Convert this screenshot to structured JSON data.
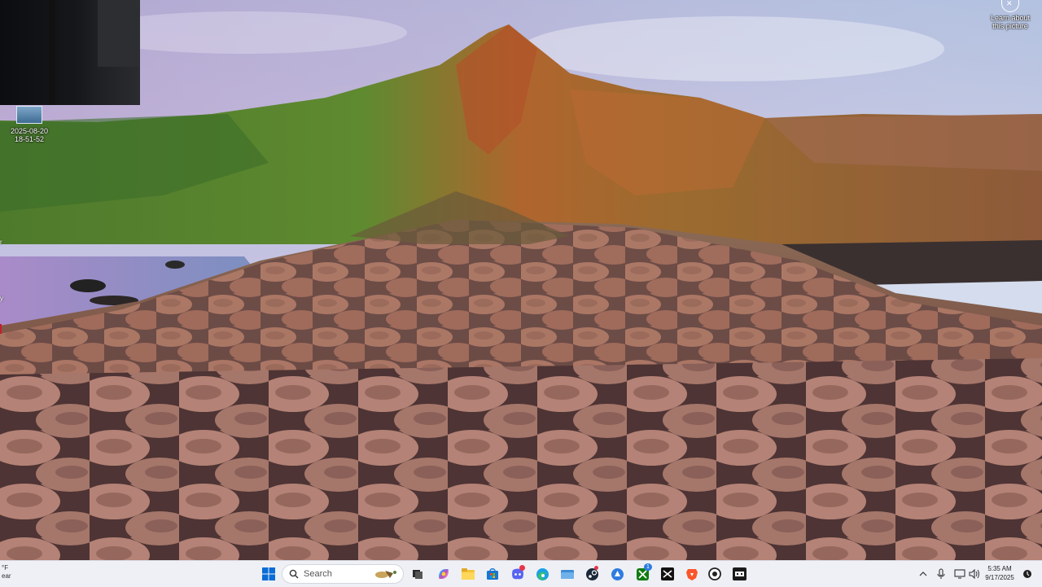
{
  "desktop": {
    "icon": {
      "label_line1": "2025-08-20",
      "label_line2": "18-51-52"
    },
    "learn_picture": {
      "line1": "Learn about",
      "line2": "this picture"
    },
    "edge_fragments": [
      "r",
      "y"
    ]
  },
  "taskbar": {
    "weather": {
      "temp": "°F",
      "condition": "ear"
    },
    "search": {
      "label": "Search"
    },
    "pinned_apps": [
      "start-icon",
      "search-box",
      "task-view-icon",
      "copilot-icon",
      "file-explorer-icon",
      "microsoft-store-icon",
      "discord-icon",
      "edge-icon",
      "files-app-icon",
      "steam-icon",
      "app-icon",
      "xbox-icon",
      "capcut-icon",
      "brave-icon",
      "github-icon",
      "video-app-icon"
    ],
    "badges": {
      "discord": "",
      "xbox": "1"
    },
    "clock": {
      "time": "5:35 AM",
      "date": "9/17/2025"
    }
  },
  "colors": {
    "taskbar_bg": "#eef0f5",
    "start_blue": "#0a6cd6"
  }
}
